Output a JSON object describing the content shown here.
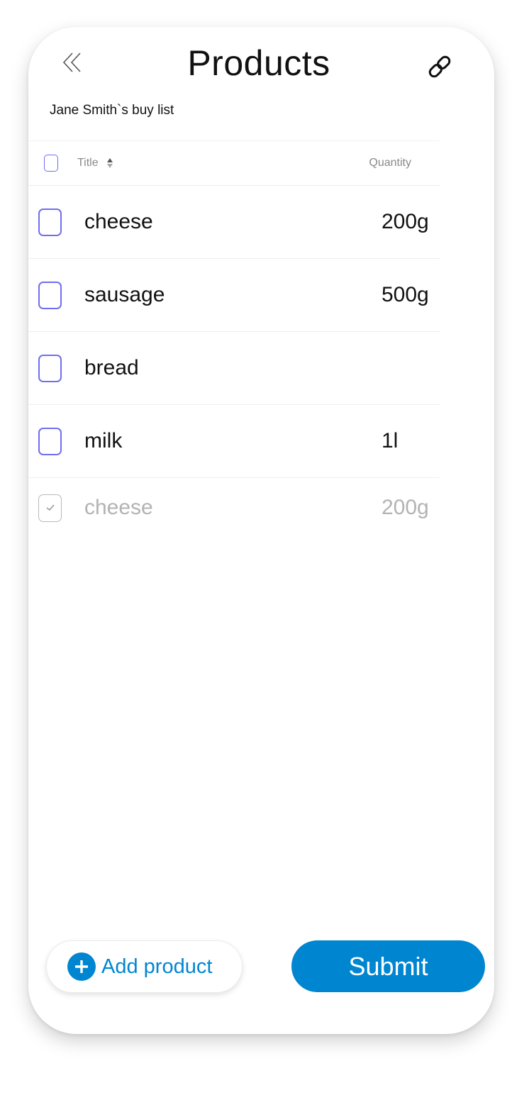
{
  "header": {
    "title": "Products",
    "subtitle": "Jane Smith`s buy list",
    "back_icon": "double-chevron-left-icon",
    "link_icon": "link-icon"
  },
  "table": {
    "columns": {
      "title": "Title",
      "quantity": "Quantity"
    },
    "items": [
      {
        "name": "cheese",
        "quantity": "200g",
        "checked": false
      },
      {
        "name": "sausage",
        "quantity": "500g",
        "checked": false
      },
      {
        "name": "bread",
        "quantity": "",
        "checked": false
      },
      {
        "name": "milk",
        "quantity": "1l",
        "checked": false
      },
      {
        "name": "cheese",
        "quantity": "200g",
        "checked": true
      }
    ]
  },
  "actions": {
    "add_label": "Add product",
    "submit_label": "Submit"
  },
  "colors": {
    "accent": "#0086d1",
    "checkbox": "#6f6ef0",
    "muted": "#b3b3b3"
  }
}
